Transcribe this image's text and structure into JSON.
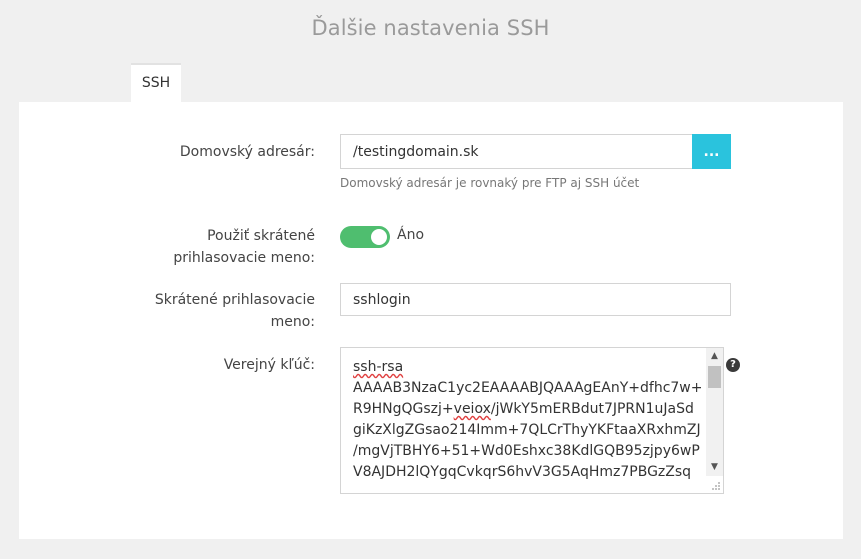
{
  "page": {
    "title": "Ďalšie nastavenia SSH"
  },
  "tabs": [
    {
      "label": "SSH"
    }
  ],
  "form": {
    "home_dir": {
      "label": "Domovský adresár:",
      "value": "/testingdomain.sk",
      "browse_label": "...",
      "help": "Domovský adresár je rovnaký pre FTP aj SSH účet"
    },
    "short_login_toggle": {
      "label_line1": "Použiť skrátené",
      "label_line2": "prihlasovacie meno:",
      "state_label": "Áno"
    },
    "short_login": {
      "label_line1": "Skrátené prihlasovacie",
      "label_line2": "meno:",
      "value": "sshlogin"
    },
    "public_key": {
      "label": "Verejný kľúč:",
      "lines": [
        "ssh-rsa",
        "AAAAB3NzaC1yc2EAAAABJQAAAgEAnY+dfhc7w+",
        "R9HNgQGszj+",
        "veiox",
        "/jWkY5mERBdut7JPRN1uJaSd",
        "giKzXlgZGsao214Imm+7QLCrThyYKFtaaXRxhmZJ",
        "/mgVjTBHY6+51+Wd0Eshxc38KdlGQB95zjpy6wP",
        "V8AJDH2lQYgqCvkqrS6hvV3G5AqHmz7PBGzZsq"
      ],
      "help_icon": "question-icon"
    }
  }
}
